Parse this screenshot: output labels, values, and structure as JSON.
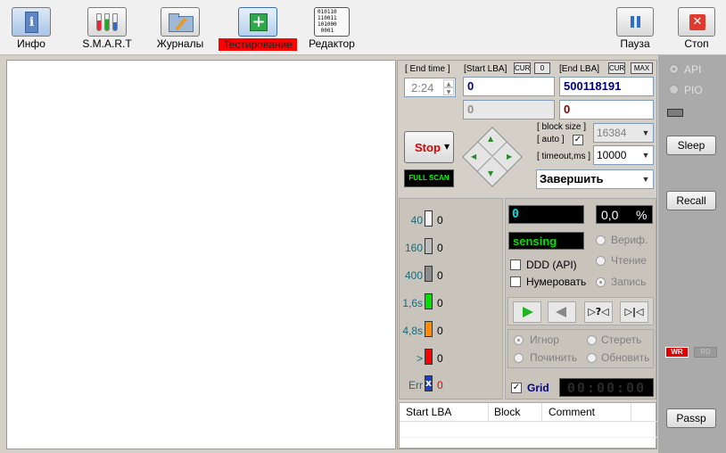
{
  "toolbar": {
    "items": [
      {
        "label": "Инфо",
        "icon": "info-icon"
      },
      {
        "label": "S.M.A.R.T",
        "icon": "smart-tubes-icon"
      },
      {
        "label": "Журналы",
        "icon": "folder-edit-icon"
      },
      {
        "label": "Тестирование",
        "icon": "first-aid-icon",
        "active": true
      },
      {
        "label": "Редактор",
        "icon": "binary-document-icon"
      }
    ],
    "binary_lines": [
      "010110",
      "110011",
      "101000",
      "0001"
    ],
    "pause_label": "Пауза",
    "stop_label": "Стоп",
    "active_color": "#ff0000"
  },
  "test": {
    "end_time_label": "[ End time ]",
    "end_time_value": "2:24",
    "start_lba_label": "[Start LBA]",
    "start_cur_chip": "CUR",
    "start_zero_chip": "0",
    "end_lba_label": "[End LBA]",
    "end_cur_chip": "CUR",
    "end_max_chip": "MAX",
    "start_lba_value": "0",
    "end_lba_value": "500118191",
    "start_lba_sub": "0",
    "end_lba_sub": "0",
    "block_size_label": "[ block size ]",
    "auto_label": "[ auto ]",
    "block_size_value": "16384",
    "timeout_label": "[ timeout,ms ]",
    "timeout_value": "10000",
    "stop_button": "Stop",
    "full_scan": "FULL SCAN",
    "finish_value": "Завершить"
  },
  "histogram": {
    "rows": [
      {
        "label": "40",
        "count": "0",
        "color": "#f4f4f4"
      },
      {
        "label": "160",
        "count": "0",
        "color": "#bdbdbd"
      },
      {
        "label": "400",
        "count": "0",
        "color": "#8c8c8c"
      },
      {
        "label": "1,6s",
        "count": "0",
        "color": "#00e000"
      },
      {
        "label": "4,8s",
        "count": "0",
        "color": "#ff8c00"
      },
      {
        "label": ">",
        "count": "0",
        "color": "#ff0000"
      },
      {
        "label": "Err",
        "count": "0",
        "color": "#1f3fbf",
        "glyph": "x"
      }
    ]
  },
  "status": {
    "block_counter": "0",
    "progress_value": "0,0",
    "progress_unit": "%",
    "state_text": "sensing",
    "ddd_label": "DDD (API)",
    "numbering_label": "Нумеровать",
    "verify_label": "Вериф.",
    "read_label": "Чтение",
    "write_label": "Запись",
    "ignore_label": "Игнор",
    "erase_label": "Стереть",
    "repair_label": "Починить",
    "refresh_label": "Обновить",
    "grid_label": "Grid",
    "grid_timer": "00:00:00"
  },
  "table": {
    "columns": [
      "Start LBA",
      "Block",
      "Comment"
    ]
  },
  "right_panel": {
    "api_label": "API",
    "pio_label": "PIO",
    "sleep_label": "Sleep",
    "recall_label": "Recall",
    "wr_label": "WR",
    "rd_label": "RD",
    "passp_label": "Passp"
  }
}
